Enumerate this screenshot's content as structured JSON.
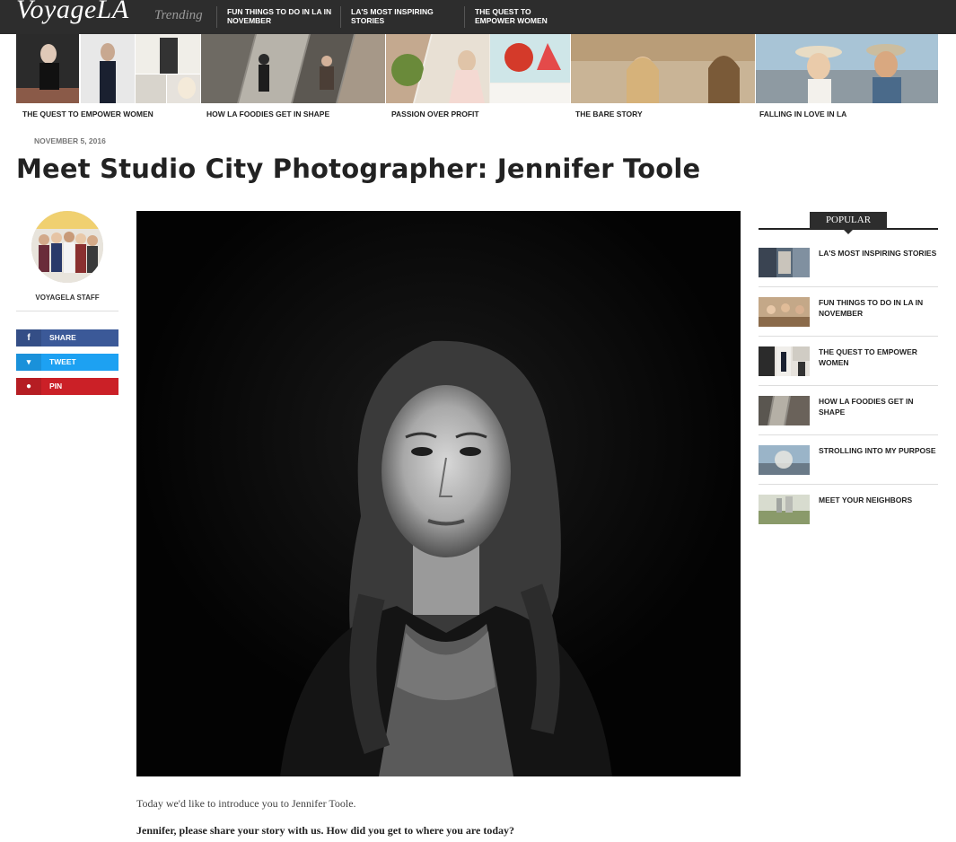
{
  "site": {
    "logo": "VoyageLA",
    "trending_label": "Trending"
  },
  "trending_links": [
    "FUN THINGS TO DO IN LA IN NOVEMBER",
    "LA'S MOST INSPIRING STORIES",
    "THE QUEST TO EMPOWER WOMEN"
  ],
  "featured": [
    {
      "label": "THE QUEST TO EMPOWER WOMEN"
    },
    {
      "label": "HOW LA FOODIES GET IN SHAPE"
    },
    {
      "label": "PASSION OVER PROFIT"
    },
    {
      "label": "THE BARE STORY"
    },
    {
      "label": "FALLING IN LOVE IN LA"
    }
  ],
  "article": {
    "date": "NOVEMBER 5, 2016",
    "title": "Meet Studio City Photographer: Jennifer Toole",
    "author": "VOYAGELA STAFF",
    "intro": "Today we'd like to introduce you to Jennifer Toole.",
    "question": "Jennifer, please share your story with us. How did you get to where you are today?"
  },
  "share": [
    {
      "label": "SHARE",
      "icon": "facebook-icon",
      "glyph": "f",
      "color": "#3b5998"
    },
    {
      "label": "TWEET",
      "icon": "twitter-icon",
      "glyph": "🐦",
      "color": "#1da1f2"
    },
    {
      "label": "PIN",
      "icon": "pinterest-icon",
      "glyph": "℗",
      "color": "#cb2027"
    }
  ],
  "sidebar": {
    "heading": "POPULAR",
    "items": [
      "LA'S MOST INSPIRING STORIES",
      "FUN THINGS TO DO IN LA IN NOVEMBER",
      "THE QUEST TO EMPOWER WOMEN",
      "HOW LA FOODIES GET IN SHAPE",
      "STROLLING INTO MY PURPOSE",
      "MEET YOUR NEIGHBORS"
    ]
  },
  "colors": {
    "nav_bg": "#2d2d2d",
    "accent": "#222222"
  }
}
